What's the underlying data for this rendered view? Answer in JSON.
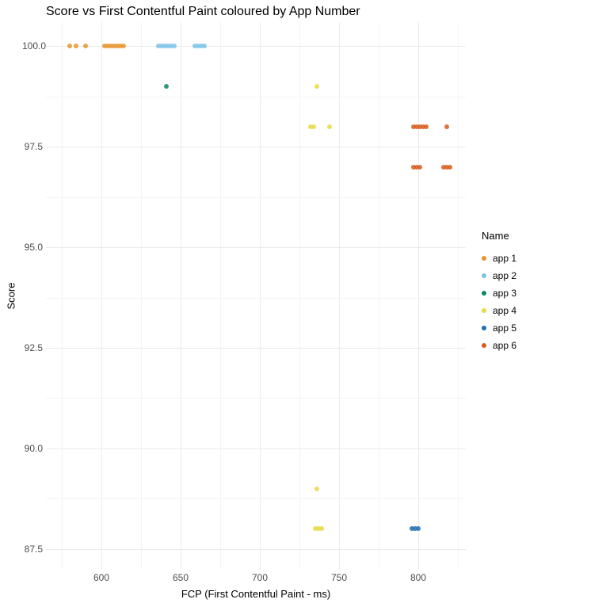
{
  "chart_data": {
    "type": "scatter",
    "title": "Score vs First Contentful Paint coloured by App Number",
    "xlabel": "FCP (First Contentful Paint - ms)",
    "ylabel": "Score",
    "xlim": [
      565,
      830
    ],
    "ylim": [
      87.0,
      100.6
    ],
    "x_ticks": [
      600,
      650,
      700,
      750,
      800
    ],
    "y_ticks": [
      87.5,
      90.0,
      92.5,
      95.0,
      97.5,
      100.0
    ],
    "x_minor": [
      575,
      625,
      675,
      725,
      775,
      825
    ],
    "y_minor": [
      88.75,
      91.25,
      93.75,
      96.25,
      98.75
    ],
    "legend_title": "Name",
    "series": [
      {
        "name": "app 1",
        "color": "#e8942c",
        "points": [
          {
            "x": 580,
            "y": 100
          },
          {
            "x": 584,
            "y": 100
          },
          {
            "x": 590,
            "y": 100
          },
          {
            "x": 602,
            "y": 100
          },
          {
            "x": 604,
            "y": 100
          },
          {
            "x": 606,
            "y": 100
          },
          {
            "x": 608,
            "y": 100
          },
          {
            "x": 610,
            "y": 100
          },
          {
            "x": 612,
            "y": 100
          },
          {
            "x": 614,
            "y": 100
          }
        ]
      },
      {
        "name": "app 2",
        "color": "#7cc3e8",
        "points": [
          {
            "x": 636,
            "y": 100
          },
          {
            "x": 638,
            "y": 100
          },
          {
            "x": 640,
            "y": 100
          },
          {
            "x": 642,
            "y": 100
          },
          {
            "x": 644,
            "y": 100
          },
          {
            "x": 646,
            "y": 100
          },
          {
            "x": 659,
            "y": 100
          },
          {
            "x": 661,
            "y": 100
          },
          {
            "x": 663,
            "y": 100
          },
          {
            "x": 665,
            "y": 100
          }
        ]
      },
      {
        "name": "app 3",
        "color": "#0a8a5a",
        "points": [
          {
            "x": 641,
            "y": 99
          }
        ]
      },
      {
        "name": "app 4",
        "color": "#e8d946",
        "points": [
          {
            "x": 736,
            "y": 99
          },
          {
            "x": 732,
            "y": 98
          },
          {
            "x": 734,
            "y": 98
          },
          {
            "x": 744,
            "y": 98
          },
          {
            "x": 736,
            "y": 89
          },
          {
            "x": 735,
            "y": 88
          },
          {
            "x": 737,
            "y": 88
          },
          {
            "x": 739,
            "y": 88
          }
        ]
      },
      {
        "name": "app 5",
        "color": "#1f6fb2",
        "points": [
          {
            "x": 796,
            "y": 88
          },
          {
            "x": 798,
            "y": 88
          },
          {
            "x": 800,
            "y": 88
          }
        ]
      },
      {
        "name": "app 6",
        "color": "#d85a1a",
        "points": [
          {
            "x": 797,
            "y": 98
          },
          {
            "x": 799,
            "y": 98
          },
          {
            "x": 801,
            "y": 98
          },
          {
            "x": 803,
            "y": 98
          },
          {
            "x": 805,
            "y": 98
          },
          {
            "x": 818,
            "y": 98
          },
          {
            "x": 797,
            "y": 97
          },
          {
            "x": 799,
            "y": 97
          },
          {
            "x": 801,
            "y": 97
          },
          {
            "x": 816,
            "y": 97
          },
          {
            "x": 818,
            "y": 97
          },
          {
            "x": 820,
            "y": 97
          }
        ]
      }
    ]
  }
}
